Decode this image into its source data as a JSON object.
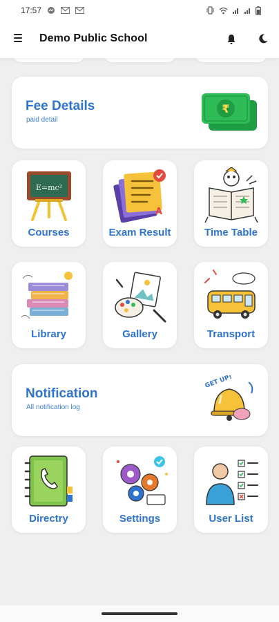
{
  "status_bar": {
    "time": "17:57",
    "left_icons": [
      "messenger-icon",
      "gmail-icon",
      "gmail-icon"
    ],
    "right_icons": [
      "vibrate-icon",
      "wifi-icon",
      "signal-icon",
      "signal-icon",
      "battery-icon"
    ]
  },
  "app_bar": {
    "title": "Demo Public School",
    "menu_icon": "menu-icon",
    "notification_icon": "bell-icon",
    "theme_icon": "moon-icon"
  },
  "fee_card": {
    "title": "Fee Details",
    "subtitle": "paid detail",
    "icon": "money-icon"
  },
  "tiles_row1": [
    {
      "label": "Courses",
      "icon": "chalkboard-icon"
    },
    {
      "label": "Exam Result",
      "icon": "exam-result-icon"
    },
    {
      "label": "Time Table",
      "icon": "time-table-icon"
    }
  ],
  "tiles_row2": [
    {
      "label": "Library",
      "icon": "books-icon"
    },
    {
      "label": "Gallery",
      "icon": "gallery-icon"
    },
    {
      "label": "Transport",
      "icon": "bus-icon"
    }
  ],
  "notification_card": {
    "title": "Notification",
    "subtitle": "All notification log",
    "icon": "alarm-bell-icon"
  },
  "tiles_row3": [
    {
      "label": "Directry",
      "icon": "phonebook-icon"
    },
    {
      "label": "Settings",
      "icon": "gears-icon"
    },
    {
      "label": "User List",
      "icon": "user-list-icon"
    }
  ],
  "colors": {
    "accent": "#2d73cf",
    "background": "#efefef",
    "card": "#ffffff"
  }
}
